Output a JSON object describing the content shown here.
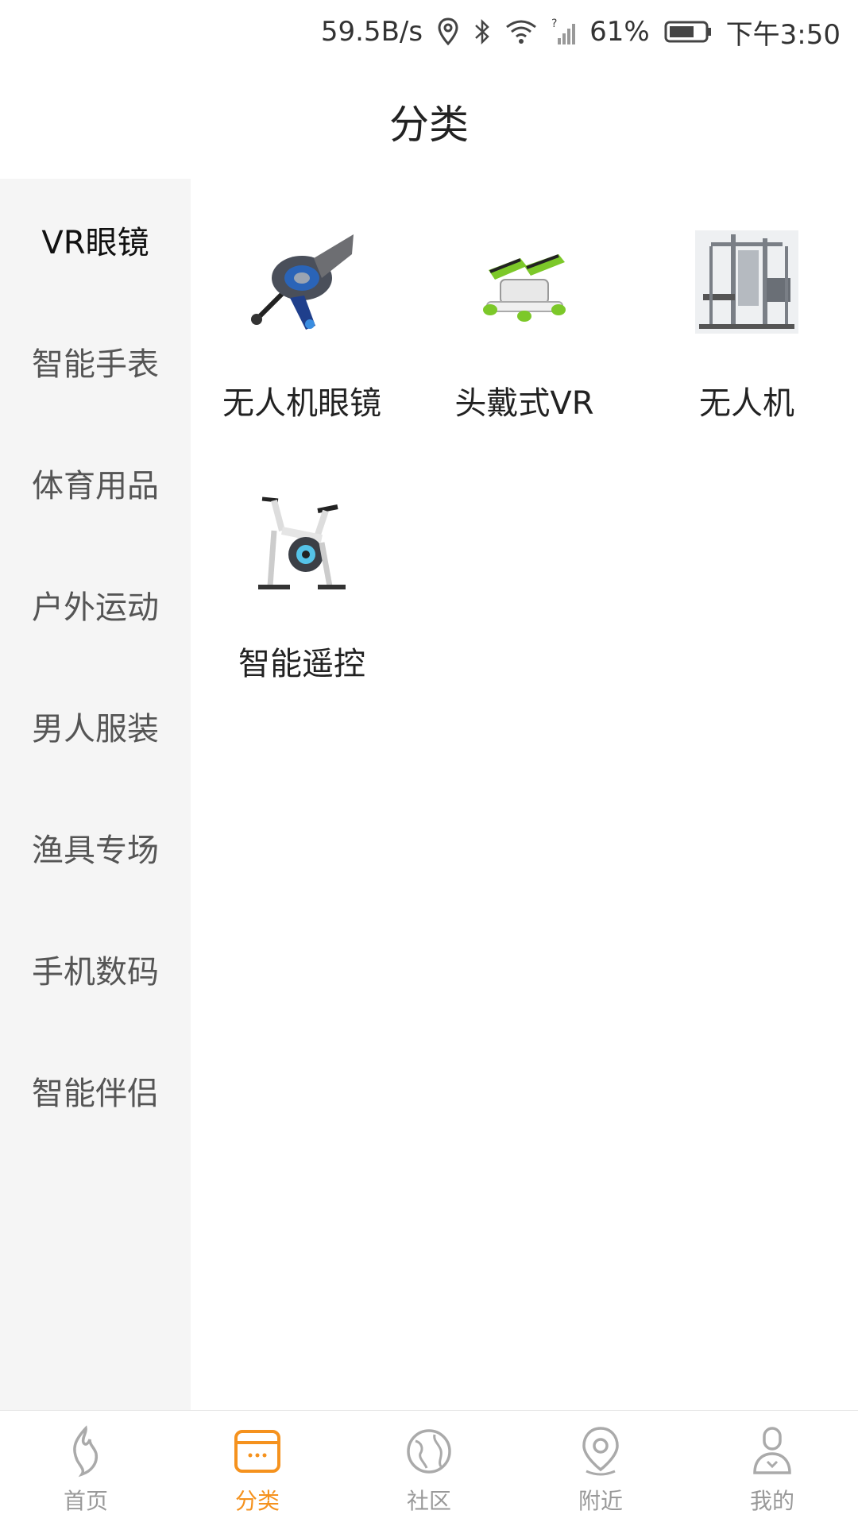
{
  "status_bar": {
    "speed": "59.5B/s",
    "battery": "61%",
    "time": "下午3:50"
  },
  "header": {
    "title": "分类"
  },
  "sidebar": {
    "items": [
      {
        "label": "VR眼镜",
        "active": true
      },
      {
        "label": "智能手表"
      },
      {
        "label": "体育用品"
      },
      {
        "label": "户外运动"
      },
      {
        "label": "男人服装"
      },
      {
        "label": "渔具专场"
      },
      {
        "label": "手机数码"
      },
      {
        "label": "智能伴侣"
      }
    ]
  },
  "grid": {
    "items": [
      {
        "label": "无人机眼镜",
        "image": "fishing-reel-image"
      },
      {
        "label": "头戴式VR",
        "image": "stepper-machine-image"
      },
      {
        "label": "无人机",
        "image": "gym-station-image"
      },
      {
        "label": "智能遥控",
        "image": "exercise-bike-image"
      }
    ]
  },
  "tab_bar": {
    "tabs": [
      {
        "label": "首页",
        "icon": "flame-icon"
      },
      {
        "label": "分类",
        "icon": "category-icon",
        "active": true
      },
      {
        "label": "社区",
        "icon": "globe-icon"
      },
      {
        "label": "附近",
        "icon": "location-icon"
      },
      {
        "label": "我的",
        "icon": "user-icon"
      }
    ]
  },
  "colors": {
    "accent": "#f5921e",
    "sidebar_bg": "#f5f5f5",
    "inactive": "#999999"
  }
}
